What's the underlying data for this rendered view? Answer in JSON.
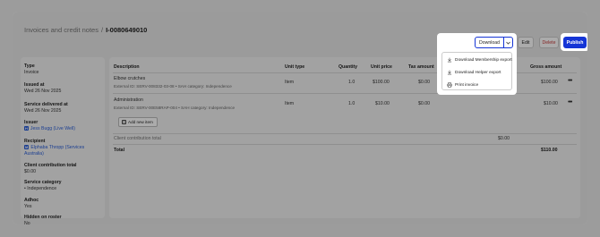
{
  "breadcrumb": {
    "parent": "Invoices and credit notes",
    "separator": "/",
    "current": "I-0080649010"
  },
  "sidebar": {
    "type": {
      "label": "Type",
      "value": "Invoice"
    },
    "issued_at": {
      "label": "Issued at",
      "value": "Wed 26 Nov 2025"
    },
    "service_delivered_at": {
      "label": "Service delivered at",
      "value": "Wed 26 Nov 2025"
    },
    "issuer": {
      "label": "Issuer",
      "tag": "H",
      "value": "Jess Bugg (Live Well)"
    },
    "recipient": {
      "label": "Recipient",
      "tag": "M",
      "value_line1": "Elphaba Thropp (Services",
      "value_line2": "Australia)"
    },
    "client_contribution_total": {
      "label": "Client contribution total",
      "value": "$0.00"
    },
    "service_category": {
      "label": "Service category",
      "value": "Independence"
    },
    "adhoc": {
      "label": "Adhoc",
      "value": "Yes"
    },
    "hidden_on_roster": {
      "label": "Hidden on roster",
      "value": "No"
    }
  },
  "table": {
    "columns": [
      "Description",
      "Unit type",
      "Quantity",
      "Unit price",
      "Tax amount",
      "Gross amount"
    ],
    "rows": [
      {
        "description": "Elbow crutches",
        "sub": "External ID: SERV-008332-03-08 • SAH category: Independence",
        "unit_type": "Item",
        "quantity": "1.0",
        "unit_price": "$100.00",
        "tax": "$0.00",
        "gross": "$100.00"
      },
      {
        "description": "Administration",
        "sub": "External ID: SERV-00E58RAP-004 • SAH category: Independence",
        "unit_type": "Item",
        "quantity": "1.0",
        "unit_price": "$10.00",
        "tax": "$0.00",
        "gross": "$10.00"
      }
    ],
    "add_item_label": "Add new item",
    "client_contribution_label": "Client contribution total",
    "client_contribution_value": "$0.00",
    "total_label": "Total",
    "total_value": "$110.00"
  },
  "actions": {
    "download_label": "Download",
    "edit_label": "Edit",
    "delete_label": "Delete",
    "publish_label": "Publish",
    "menu": [
      {
        "label": "Download Membership export",
        "icon": "download-icon"
      },
      {
        "label": "Download Helper export",
        "icon": "download-icon"
      },
      {
        "label": "Print invoice",
        "icon": "printer-icon"
      }
    ]
  },
  "colors": {
    "accent": "#1535d6",
    "link": "#2b5fd9",
    "danger": "#c63a3a",
    "backdrop": "#9c9c9c"
  }
}
